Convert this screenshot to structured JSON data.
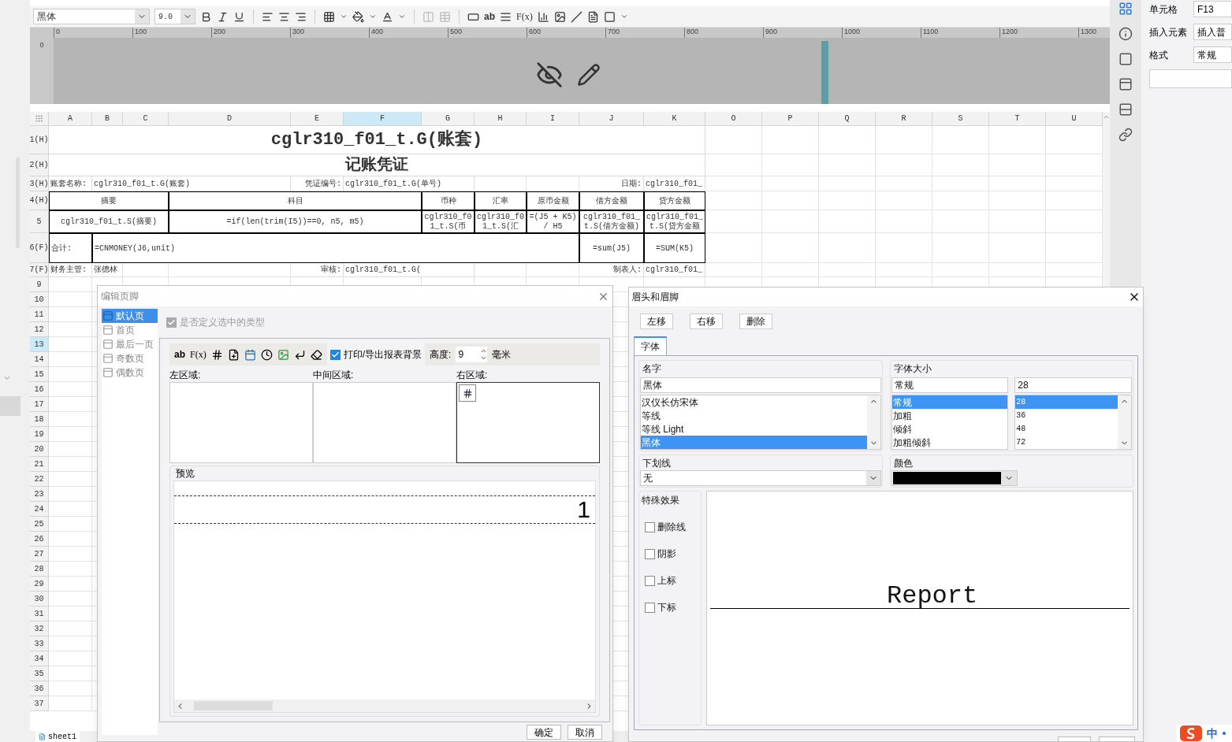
{
  "toolbar": {
    "font": "黑体",
    "size": "9.0",
    "text_tools": [
      "ab",
      "F(x)"
    ]
  },
  "ruler": {
    "marks": [
      "0",
      "100",
      "200",
      "300",
      "400",
      "500",
      "600",
      "700",
      "800",
      "900",
      "1000",
      "1100",
      "1200",
      "1300"
    ],
    "vertical_marks": [
      "0"
    ]
  },
  "sheet": {
    "columns": [
      {
        "label": "A",
        "selected": false
      },
      {
        "label": "B",
        "selected": false
      },
      {
        "label": "C",
        "selected": false
      },
      {
        "label": "D",
        "selected": false
      },
      {
        "label": "E",
        "selected": false
      },
      {
        "label": "F",
        "selected": true
      },
      {
        "label": "G",
        "selected": false
      },
      {
        "label": "H",
        "selected": false
      },
      {
        "label": "I",
        "selected": false
      },
      {
        "label": "J",
        "selected": false
      },
      {
        "label": "K",
        "selected": false
      },
      {
        "label": "O",
        "selected": false
      },
      {
        "label": "P",
        "selected": false
      },
      {
        "label": "Q",
        "selected": false
      },
      {
        "label": "R",
        "selected": false
      },
      {
        "label": "S",
        "selected": false
      },
      {
        "label": "T",
        "selected": false
      },
      {
        "label": "U",
        "selected": false
      }
    ],
    "rows": [
      {
        "label": "1(H)",
        "selected": false,
        "bordered": false,
        "cells": [
          {
            "kind": "title",
            "text": "cglr310_f01_t.G(账套)"
          }
        ]
      },
      {
        "label": "2(H)",
        "selected": false,
        "bordered": false,
        "cells": [
          {
            "kind": "subtitle",
            "text": "记账凭证"
          }
        ]
      },
      {
        "label": "3(H)",
        "selected": false,
        "bordered": false,
        "cells": [
          {
            "kind": "left",
            "text": "账套名称:"
          },
          {
            "kind": "left",
            "text": "cglr310_f01_t.G(账套)"
          },
          {
            "kind": "right",
            "text": "凭证编号:"
          },
          {
            "kind": "left",
            "text": "cglr310_f01_t.G(单号)"
          },
          {
            "kind": "right",
            "text": "日期:"
          },
          {
            "kind": "left",
            "text": "cglr310_f01_"
          }
        ]
      },
      {
        "label": "4(H)",
        "selected": false,
        "bordered": true,
        "cells": [
          {
            "kind": "center",
            "text": "摘要"
          },
          {
            "kind": "center",
            "text": "科目"
          },
          {
            "kind": "center",
            "text": "币种"
          },
          {
            "kind": "center",
            "text": "汇率"
          },
          {
            "kind": "center",
            "text": "原币金额"
          },
          {
            "kind": "center",
            "text": "借方金额"
          },
          {
            "kind": "center",
            "text": "贷方金额"
          }
        ]
      },
      {
        "label": "5",
        "selected": false,
        "bordered": true,
        "cells": [
          {
            "kind": "center",
            "text": "cglr310_f01_t.S(摘要)"
          },
          {
            "kind": "center",
            "text": "=if(len(trim(I5))==0, n5, m5)"
          },
          {
            "kind": "center",
            "text": "cglr310_f01_t.S(币"
          },
          {
            "kind": "center",
            "text": "cglr310_f01_t.S(汇"
          },
          {
            "kind": "center",
            "text": "=(J5 + K5) / H5"
          },
          {
            "kind": "center",
            "text": "cglr310_f01_t.S(借方金额)"
          },
          {
            "kind": "center",
            "text": "cglr310_f01_t.S(贷方金额"
          }
        ]
      },
      {
        "label": "6(F)",
        "selected": false,
        "bordered": true,
        "cells": [
          {
            "kind": "left",
            "text": "合计:"
          },
          {
            "kind": "left",
            "text": "=CNMONEY(J6,unit)"
          },
          {
            "kind": "center",
            "text": "=sum(J5)"
          },
          {
            "kind": "center",
            "text": "=SUM(K5)"
          }
        ]
      },
      {
        "label": "7(F)",
        "selected": false,
        "bordered": false,
        "cells": [
          {
            "kind": "left",
            "text": "财务主管:"
          },
          {
            "kind": "left",
            "text": "张德林"
          },
          {
            "kind": "right",
            "text": "审核:"
          },
          {
            "kind": "left",
            "text": "cglr310_f01_t.G("
          },
          {
            "kind": "right",
            "text": "制表人:"
          },
          {
            "kind": "left",
            "text": "cglr310_f01_"
          }
        ]
      },
      {
        "label": "9",
        "selected": false
      },
      {
        "label": "10",
        "selected": false
      },
      {
        "label": "11",
        "selected": false
      },
      {
        "label": "12",
        "selected": false
      },
      {
        "label": "13",
        "selected": true
      },
      {
        "label": "14",
        "selected": false
      },
      {
        "label": "15",
        "selected": false
      },
      {
        "label": "16",
        "selected": false
      },
      {
        "label": "17",
        "selected": false
      },
      {
        "label": "18",
        "selected": false
      },
      {
        "label": "19",
        "selected": false
      },
      {
        "label": "20",
        "selected": false
      },
      {
        "label": "21",
        "selected": false
      },
      {
        "label": "22",
        "selected": false
      },
      {
        "label": "23",
        "selected": false
      },
      {
        "label": "24",
        "selected": false
      },
      {
        "label": "25",
        "selected": false
      },
      {
        "label": "26",
        "selected": false
      },
      {
        "label": "27",
        "selected": false
      },
      {
        "label": "28",
        "selected": false
      },
      {
        "label": "29",
        "selected": false
      },
      {
        "label": "30",
        "selected": false
      },
      {
        "label": "31",
        "selected": false
      },
      {
        "label": "32",
        "selected": false
      },
      {
        "label": "33",
        "selected": false
      },
      {
        "label": "34",
        "selected": false
      },
      {
        "label": "35",
        "selected": false
      },
      {
        "label": "36",
        "selected": false
      },
      {
        "label": "37",
        "selected": false
      }
    ]
  },
  "sheet_tabs": [
    {
      "label": "sheet1",
      "selected": true
    }
  ],
  "side_panel": {
    "fields": [
      {
        "label": "单元格",
        "value": "F13"
      },
      {
        "label": "插入元素",
        "value": "插入普"
      },
      {
        "label": "格式",
        "value": "常规"
      }
    ]
  },
  "footer_dialog": {
    "title": "编辑页脚",
    "pages": [
      {
        "label": "默认页",
        "selected": true
      },
      {
        "label": "首页",
        "selected": false
      },
      {
        "label": "最后一页",
        "selected": false
      },
      {
        "label": "奇数页",
        "selected": false
      },
      {
        "label": "偶数页",
        "selected": false
      }
    ],
    "define_type": {
      "label": "是否定义选中的类型",
      "checked": true,
      "disabled": true
    },
    "text_tools": [
      "ab",
      "F(x)"
    ],
    "print_background": {
      "label": "打印/导出报表背景",
      "checked": true
    },
    "height": {
      "label": "高度:",
      "value": "9",
      "unit": "毫米"
    },
    "regions": [
      {
        "label": "左区域:"
      },
      {
        "label": "中间区域:"
      },
      {
        "label": "右区域:",
        "items": [
          {
            "kind": "page-number"
          }
        ]
      }
    ],
    "preview": {
      "label": "预览",
      "text": "1"
    },
    "buttons": [
      "确定",
      "取消"
    ]
  },
  "header_dialog": {
    "title": "眉头和眉脚",
    "buttons": [
      "左移",
      "右移",
      "删除"
    ],
    "tabs": [
      {
        "label": "字体",
        "selected": true
      }
    ],
    "name": {
      "label": "名字",
      "value": "黑体",
      "options": [
        {
          "label": "汉仪长仿宋体",
          "selected": false
        },
        {
          "label": "等线",
          "selected": false
        },
        {
          "label": "等线 Light",
          "selected": false
        },
        {
          "label": "黑体",
          "selected": true
        }
      ]
    },
    "style": {
      "label": "字体大小",
      "value": "常规",
      "options": [
        {
          "label": "常规",
          "selected": true
        },
        {
          "label": "加粗",
          "selected": false
        },
        {
          "label": "倾斜",
          "selected": false
        },
        {
          "label": "加粗倾斜",
          "selected": false
        }
      ]
    },
    "size": {
      "value": "28",
      "options": [
        {
          "label": "28",
          "selected": true
        },
        {
          "label": "36",
          "selected": false
        },
        {
          "label": "48",
          "selected": false
        },
        {
          "label": "72",
          "selected": false
        }
      ]
    },
    "underline": {
      "label": "下划线",
      "value": "无"
    },
    "color": {
      "label": "颜色",
      "color": "#000000"
    },
    "effects": {
      "label": "特殊效果",
      "options": [
        {
          "label": "删除线",
          "checked": false
        },
        {
          "label": "阴影",
          "checked": false
        },
        {
          "label": "上标",
          "checked": false
        },
        {
          "label": "下标",
          "checked": false
        }
      ]
    },
    "preview": {
      "text": "Report"
    }
  },
  "ime": {
    "mode": "中"
  }
}
